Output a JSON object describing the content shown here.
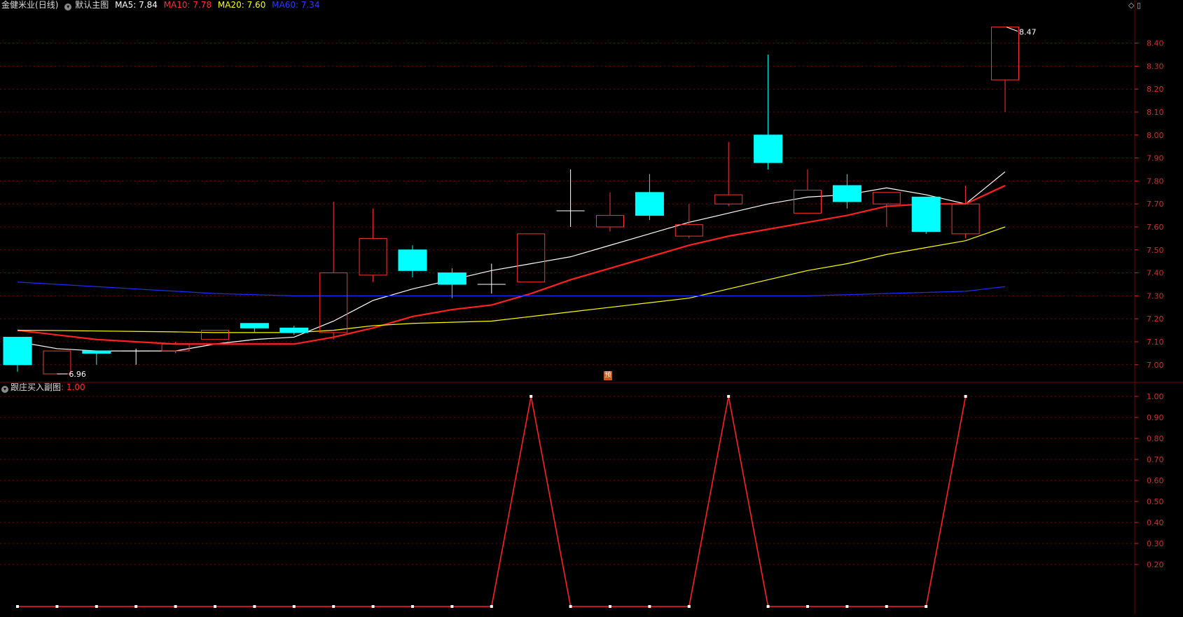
{
  "header": {
    "stock_name": "金健米业",
    "period": "(日线)",
    "template": "默认主图",
    "ma5_label": "MA5: 7.84",
    "ma10_label": "MA10: 7.78",
    "ma20_label": "MA20: 7.60",
    "ma60_label": "MA60: 7.34"
  },
  "colors": {
    "background": "#000000",
    "grid": "#7a0000",
    "axis_text": "#c83232",
    "up_candle": "#ff3232",
    "down_candle": "#00ffff",
    "ma5": "#ffffff",
    "ma10": "#ff2020",
    "ma20": "#ffff00",
    "ma60": "#1c2bff",
    "indicator": "#ff2020"
  },
  "subchart": {
    "title": "跟庄买入副图",
    "value_label": ": 1.00"
  },
  "marker": {
    "label": "预"
  },
  "annotations": {
    "high": "8.47",
    "low": "6.96"
  },
  "chart_data": [
    {
      "type": "candlestick",
      "y_ticks": [
        "8.40",
        "8.30",
        "8.20",
        "8.10",
        "8.00",
        "7.90",
        "7.80",
        "7.70",
        "7.60",
        "7.50",
        "7.40",
        "7.30",
        "7.20",
        "7.10",
        "7.00"
      ],
      "ylim": [
        6.91,
        8.48
      ],
      "candles": [
        {
          "open": 7.12,
          "high": 7.12,
          "low": 6.97,
          "close": 7.0
        },
        {
          "open": 6.96,
          "high": 7.06,
          "low": 6.96,
          "close": 7.06
        },
        {
          "open": 7.06,
          "high": 7.06,
          "low": 7.0,
          "close": 7.05
        },
        {
          "open": 7.06,
          "high": 7.07,
          "low": 7.0,
          "close": 7.06
        },
        {
          "open": 7.06,
          "high": 7.1,
          "low": 7.05,
          "close": 7.09
        },
        {
          "open": 7.11,
          "high": 7.15,
          "low": 7.11,
          "close": 7.15
        },
        {
          "open": 7.18,
          "high": 7.18,
          "low": 7.14,
          "close": 7.16
        },
        {
          "open": 7.16,
          "high": 7.17,
          "low": 7.13,
          "close": 7.14
        },
        {
          "open": 7.14,
          "high": 7.71,
          "low": 7.11,
          "close": 7.4
        },
        {
          "open": 7.39,
          "high": 7.68,
          "low": 7.36,
          "close": 7.55
        },
        {
          "open": 7.5,
          "high": 7.52,
          "low": 7.38,
          "close": 7.41
        },
        {
          "open": 7.4,
          "high": 7.42,
          "low": 7.29,
          "close": 7.35
        },
        {
          "open": 7.35,
          "high": 7.44,
          "low": 7.31,
          "close": 7.35
        },
        {
          "open": 7.36,
          "high": 7.57,
          "low": 7.36,
          "close": 7.57
        },
        {
          "open": 7.67,
          "high": 7.85,
          "low": 7.6,
          "close": 7.67
        },
        {
          "open": 7.6,
          "high": 7.75,
          "low": 7.58,
          "close": 7.65
        },
        {
          "open": 7.75,
          "high": 7.83,
          "low": 7.63,
          "close": 7.65
        },
        {
          "open": 7.56,
          "high": 7.7,
          "low": 7.55,
          "close": 7.61
        },
        {
          "open": 7.7,
          "high": 7.97,
          "low": 7.69,
          "close": 7.74
        },
        {
          "open": 8.0,
          "high": 8.35,
          "low": 7.85,
          "close": 7.88
        },
        {
          "open": 7.66,
          "high": 7.85,
          "low": 7.66,
          "close": 7.76
        },
        {
          "open": 7.78,
          "high": 7.83,
          "low": 7.68,
          "close": 7.71
        },
        {
          "open": 7.7,
          "high": 7.75,
          "low": 7.6,
          "close": 7.75
        },
        {
          "open": 7.73,
          "high": 7.73,
          "low": 7.57,
          "close": 7.58
        },
        {
          "open": 7.57,
          "high": 7.78,
          "low": 7.55,
          "close": 7.7
        },
        {
          "open": 8.24,
          "high": 8.47,
          "low": 8.1,
          "close": 8.47
        }
      ],
      "ma": [
        {
          "name": "MA5",
          "values": [
            7.1,
            7.07,
            7.06,
            7.06,
            7.06,
            7.09,
            7.11,
            7.12,
            7.19,
            7.28,
            7.33,
            7.37,
            7.41,
            7.44,
            7.47,
            7.52,
            7.57,
            7.62,
            7.66,
            7.7,
            7.73,
            7.74,
            7.77,
            7.74,
            7.7,
            7.84
          ]
        },
        {
          "name": "MA10",
          "values": [
            7.15,
            7.13,
            7.11,
            7.1,
            7.09,
            7.09,
            7.09,
            7.09,
            7.12,
            7.16,
            7.21,
            7.24,
            7.26,
            7.31,
            7.37,
            7.42,
            7.47,
            7.52,
            7.56,
            7.59,
            7.62,
            7.65,
            7.69,
            7.7,
            7.7,
            7.78
          ]
        },
        {
          "name": "MA20",
          "values": [
            7.15,
            7.149,
            7.147,
            7.145,
            7.143,
            7.14,
            7.14,
            7.14,
            7.15,
            7.17,
            7.18,
            7.185,
            7.19,
            7.21,
            7.23,
            7.25,
            7.27,
            7.29,
            7.33,
            7.37,
            7.41,
            7.44,
            7.48,
            7.51,
            7.54,
            7.6
          ]
        },
        {
          "name": "MA60",
          "values": [
            7.36,
            7.35,
            7.34,
            7.33,
            7.32,
            7.31,
            7.305,
            7.3,
            7.3,
            7.3,
            7.3,
            7.3,
            7.3,
            7.3,
            7.3,
            7.3,
            7.3,
            7.3,
            7.3,
            7.3,
            7.3,
            7.305,
            7.31,
            7.315,
            7.32,
            7.34
          ]
        }
      ]
    },
    {
      "type": "line",
      "title": "跟庄买入副图",
      "y_ticks": [
        "1.00",
        "0.90",
        "0.80",
        "0.70",
        "0.60",
        "0.50",
        "0.40",
        "0.30",
        "0.20"
      ],
      "ylim": [
        0,
        1
      ],
      "values": [
        0,
        0,
        0,
        0,
        0,
        0,
        0,
        0,
        0,
        0,
        0,
        0,
        0,
        1,
        0,
        0,
        0,
        0,
        1,
        0,
        0,
        0,
        0,
        0,
        1
      ]
    }
  ]
}
